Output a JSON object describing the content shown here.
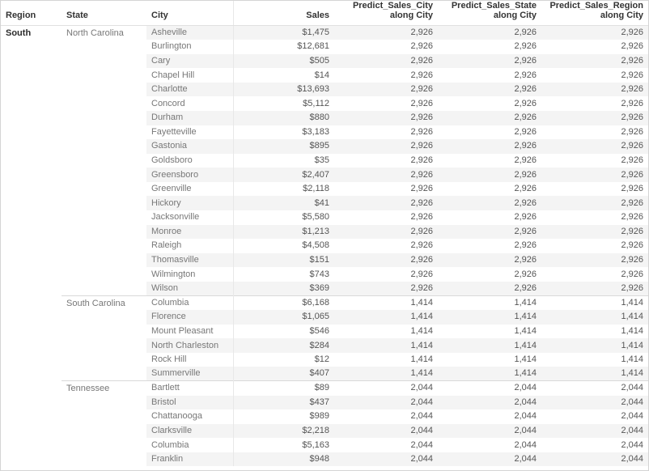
{
  "table": {
    "columns": [
      {
        "key": "region",
        "label": "Region",
        "align": "left"
      },
      {
        "key": "state",
        "label": "State",
        "align": "left"
      },
      {
        "key": "city",
        "label": "City",
        "align": "left"
      },
      {
        "key": "sales",
        "label": "Sales",
        "align": "right"
      },
      {
        "key": "p_city",
        "label": "Predict_Sales_City along City",
        "align": "right"
      },
      {
        "key": "p_state",
        "label": "Predict_Sales_State along City",
        "align": "right"
      },
      {
        "key": "p_region",
        "label": "Predict_Sales_Region along City",
        "align": "right"
      }
    ],
    "header_lines": {
      "region": [
        "Region"
      ],
      "state": [
        "State"
      ],
      "city": [
        "City"
      ],
      "sales": [
        "Sales"
      ],
      "p_city": [
        "Predict_Sales_City",
        "along City"
      ],
      "p_state": [
        "Predict_Sales_State",
        "along City"
      ],
      "p_region": [
        "Predict_Sales_Region",
        "along City"
      ]
    },
    "rows": [
      {
        "region": "South",
        "state": "North Carolina",
        "city": "Asheville",
        "sales": "$1,475",
        "p_city": "2,926",
        "p_state": "2,926",
        "p_region": "2,926",
        "group_start": true
      },
      {
        "region": "",
        "state": "",
        "city": "Burlington",
        "sales": "$12,681",
        "p_city": "2,926",
        "p_state": "2,926",
        "p_region": "2,926",
        "group_start": false
      },
      {
        "region": "",
        "state": "",
        "city": "Cary",
        "sales": "$505",
        "p_city": "2,926",
        "p_state": "2,926",
        "p_region": "2,926",
        "group_start": false
      },
      {
        "region": "",
        "state": "",
        "city": "Chapel Hill",
        "sales": "$14",
        "p_city": "2,926",
        "p_state": "2,926",
        "p_region": "2,926",
        "group_start": false
      },
      {
        "region": "",
        "state": "",
        "city": "Charlotte",
        "sales": "$13,693",
        "p_city": "2,926",
        "p_state": "2,926",
        "p_region": "2,926",
        "group_start": false
      },
      {
        "region": "",
        "state": "",
        "city": "Concord",
        "sales": "$5,112",
        "p_city": "2,926",
        "p_state": "2,926",
        "p_region": "2,926",
        "group_start": false
      },
      {
        "region": "",
        "state": "",
        "city": "Durham",
        "sales": "$880",
        "p_city": "2,926",
        "p_state": "2,926",
        "p_region": "2,926",
        "group_start": false
      },
      {
        "region": "",
        "state": "",
        "city": "Fayetteville",
        "sales": "$3,183",
        "p_city": "2,926",
        "p_state": "2,926",
        "p_region": "2,926",
        "group_start": false
      },
      {
        "region": "",
        "state": "",
        "city": "Gastonia",
        "sales": "$895",
        "p_city": "2,926",
        "p_state": "2,926",
        "p_region": "2,926",
        "group_start": false
      },
      {
        "region": "",
        "state": "",
        "city": "Goldsboro",
        "sales": "$35",
        "p_city": "2,926",
        "p_state": "2,926",
        "p_region": "2,926",
        "group_start": false
      },
      {
        "region": "",
        "state": "",
        "city": "Greensboro",
        "sales": "$2,407",
        "p_city": "2,926",
        "p_state": "2,926",
        "p_region": "2,926",
        "group_start": false
      },
      {
        "region": "",
        "state": "",
        "city": "Greenville",
        "sales": "$2,118",
        "p_city": "2,926",
        "p_state": "2,926",
        "p_region": "2,926",
        "group_start": false
      },
      {
        "region": "",
        "state": "",
        "city": "Hickory",
        "sales": "$41",
        "p_city": "2,926",
        "p_state": "2,926",
        "p_region": "2,926",
        "group_start": false
      },
      {
        "region": "",
        "state": "",
        "city": "Jacksonville",
        "sales": "$5,580",
        "p_city": "2,926",
        "p_state": "2,926",
        "p_region": "2,926",
        "group_start": false
      },
      {
        "region": "",
        "state": "",
        "city": "Monroe",
        "sales": "$1,213",
        "p_city": "2,926",
        "p_state": "2,926",
        "p_region": "2,926",
        "group_start": false
      },
      {
        "region": "",
        "state": "",
        "city": "Raleigh",
        "sales": "$4,508",
        "p_city": "2,926",
        "p_state": "2,926",
        "p_region": "2,926",
        "group_start": false
      },
      {
        "region": "",
        "state": "",
        "city": "Thomasville",
        "sales": "$151",
        "p_city": "2,926",
        "p_state": "2,926",
        "p_region": "2,926",
        "group_start": false
      },
      {
        "region": "",
        "state": "",
        "city": "Wilmington",
        "sales": "$743",
        "p_city": "2,926",
        "p_state": "2,926",
        "p_region": "2,926",
        "group_start": false
      },
      {
        "region": "",
        "state": "",
        "city": "Wilson",
        "sales": "$369",
        "p_city": "2,926",
        "p_state": "2,926",
        "p_region": "2,926",
        "group_start": false
      },
      {
        "region": "",
        "state": "South Carolina",
        "city": "Columbia",
        "sales": "$6,168",
        "p_city": "1,414",
        "p_state": "1,414",
        "p_region": "1,414",
        "group_start": true
      },
      {
        "region": "",
        "state": "",
        "city": "Florence",
        "sales": "$1,065",
        "p_city": "1,414",
        "p_state": "1,414",
        "p_region": "1,414",
        "group_start": false
      },
      {
        "region": "",
        "state": "",
        "city": "Mount Pleasant",
        "sales": "$546",
        "p_city": "1,414",
        "p_state": "1,414",
        "p_region": "1,414",
        "group_start": false
      },
      {
        "region": "",
        "state": "",
        "city": "North Charleston",
        "sales": "$284",
        "p_city": "1,414",
        "p_state": "1,414",
        "p_region": "1,414",
        "group_start": false
      },
      {
        "region": "",
        "state": "",
        "city": "Rock Hill",
        "sales": "$12",
        "p_city": "1,414",
        "p_state": "1,414",
        "p_region": "1,414",
        "group_start": false
      },
      {
        "region": "",
        "state": "",
        "city": "Summerville",
        "sales": "$407",
        "p_city": "1,414",
        "p_state": "1,414",
        "p_region": "1,414",
        "group_start": false
      },
      {
        "region": "",
        "state": "Tennessee",
        "city": "Bartlett",
        "sales": "$89",
        "p_city": "2,044",
        "p_state": "2,044",
        "p_region": "2,044",
        "group_start": true
      },
      {
        "region": "",
        "state": "",
        "city": "Bristol",
        "sales": "$437",
        "p_city": "2,044",
        "p_state": "2,044",
        "p_region": "2,044",
        "group_start": false
      },
      {
        "region": "",
        "state": "",
        "city": "Chattanooga",
        "sales": "$989",
        "p_city": "2,044",
        "p_state": "2,044",
        "p_region": "2,044",
        "group_start": false
      },
      {
        "region": "",
        "state": "",
        "city": "Clarksville",
        "sales": "$2,218",
        "p_city": "2,044",
        "p_state": "2,044",
        "p_region": "2,044",
        "group_start": false
      },
      {
        "region": "",
        "state": "",
        "city": "Columbia",
        "sales": "$5,163",
        "p_city": "2,044",
        "p_state": "2,044",
        "p_region": "2,044",
        "group_start": false
      },
      {
        "region": "",
        "state": "",
        "city": "Franklin",
        "sales": "$948",
        "p_city": "2,044",
        "p_state": "2,044",
        "p_region": "2,044",
        "group_start": false
      }
    ]
  },
  "colors": {
    "frame_border": "#d4d4d4",
    "header_text": "#333333",
    "body_text": "#6b6b6b",
    "band_background": "#f4f4f4",
    "divider": "#d9d9d9",
    "column_rule": "#e8e8e8"
  }
}
